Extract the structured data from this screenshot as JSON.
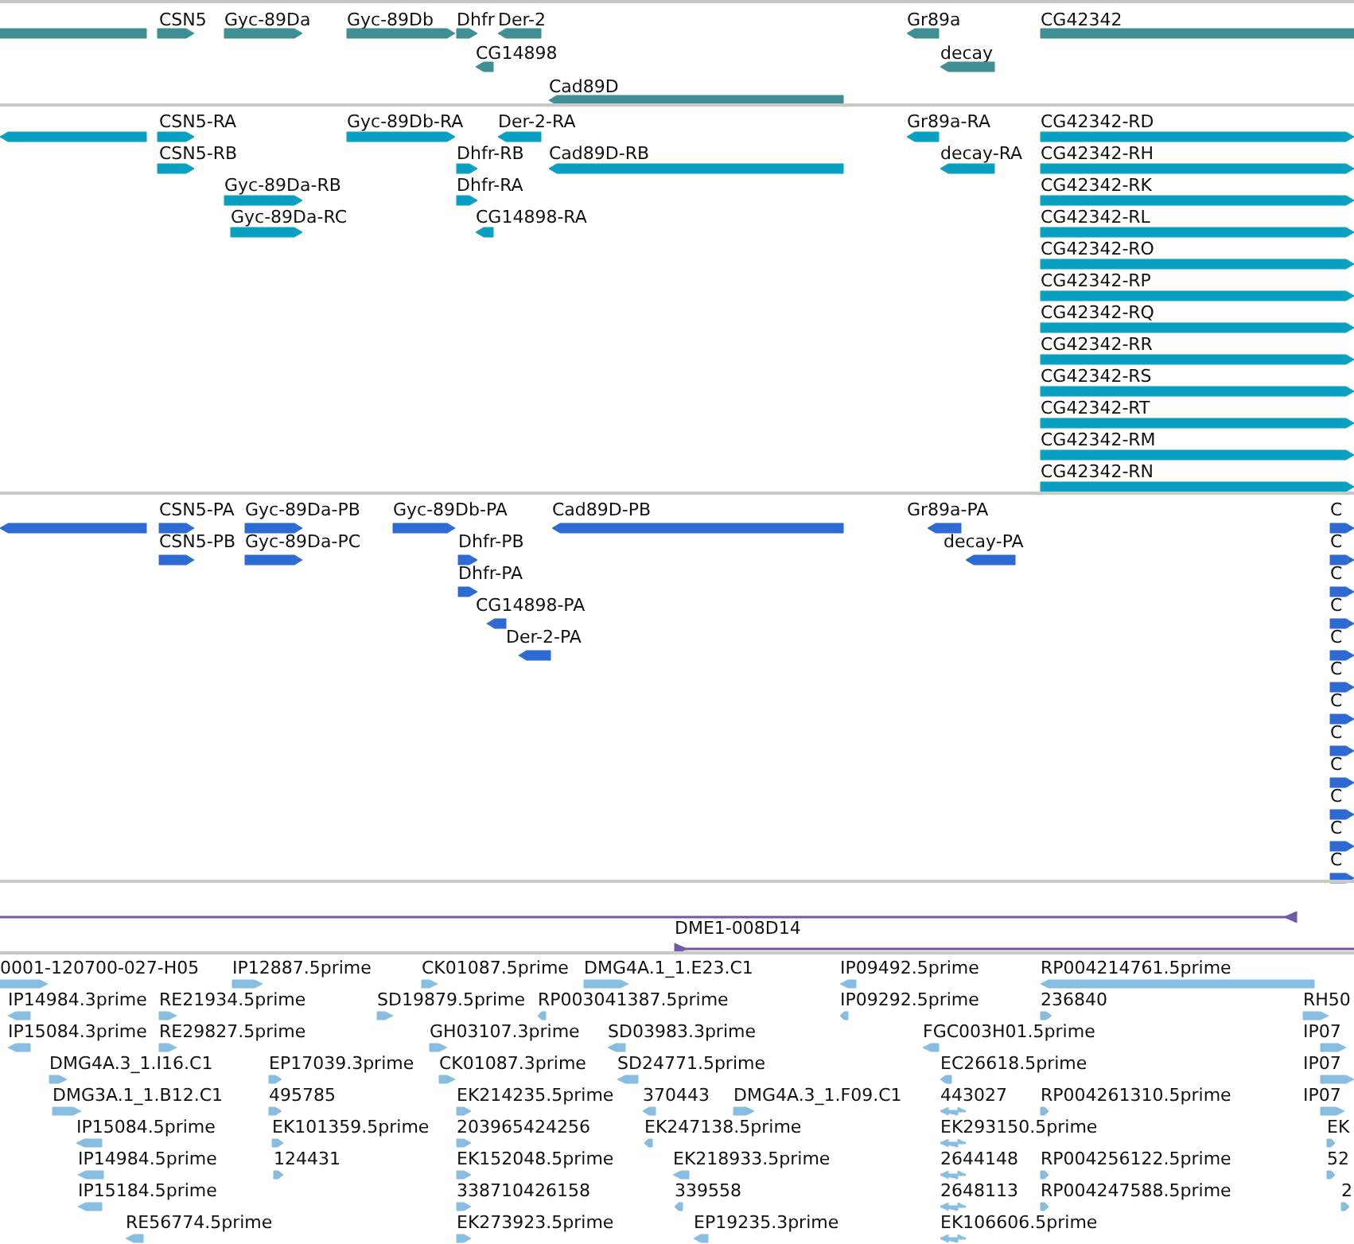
{
  "tracks": [
    {
      "kind": "bar",
      "color": "#3f8f94",
      "features": [
        {
          "kind": "plain"
        },
        {
          "label": "CSN5",
          "kind": "forward"
        },
        {
          "label": "Gyc-89Da",
          "kind": "forward"
        },
        {
          "label": "Gyc-89Db",
          "kind": "forward"
        },
        {
          "label": "Dhfr",
          "kind": "forward"
        },
        {
          "label": "Der-2",
          "kind": "reverse"
        },
        {
          "label": "Gr89a",
          "kind": "reverse"
        },
        {
          "label": "CG42342",
          "kind": "plain"
        },
        {
          "label": "CG14898",
          "kind": "reverse"
        },
        {
          "label": "decay",
          "kind": "reverse"
        },
        {
          "label": "Cad89D",
          "kind": "reverse"
        }
      ]
    },
    {
      "kind": "bar",
      "color": "#0aa0c3",
      "features": [
        {
          "kind": "reverse"
        },
        {
          "label": "CSN5-RA",
          "kind": "forward"
        },
        {
          "label": "Gyc-89Db-RA",
          "kind": "forward"
        },
        {
          "label": "Der-2-RA",
          "kind": "reverse"
        },
        {
          "label": "Gr89a-RA",
          "kind": "reverse"
        },
        {
          "label": "CG42342-RD",
          "kind": "forward"
        },
        {
          "label": "CSN5-RB",
          "kind": "forward"
        },
        {
          "label": "Dhfr-RB",
          "kind": "forward"
        },
        {
          "label": "Cad89D-RB",
          "kind": "reverse"
        },
        {
          "label": "decay-RA",
          "kind": "reverse"
        },
        {
          "label": "CG42342-RH",
          "kind": "forward"
        },
        {
          "label": "Gyc-89Da-RB",
          "kind": "forward"
        },
        {
          "label": "Dhfr-RA",
          "kind": "forward"
        },
        {
          "label": "CG42342-RK",
          "kind": "forward"
        },
        {
          "label": "Gyc-89Da-RC",
          "kind": "forward"
        },
        {
          "label": "CG14898-RA",
          "kind": "reverse"
        },
        {
          "label": "CG42342-RL",
          "kind": "forward"
        },
        {
          "label": "CG42342-RO",
          "kind": "forward"
        },
        {
          "label": "CG42342-RP",
          "kind": "forward"
        },
        {
          "label": "CG42342-RQ",
          "kind": "forward"
        },
        {
          "label": "CG42342-RR",
          "kind": "forward"
        },
        {
          "label": "CG42342-RS",
          "kind": "forward"
        },
        {
          "label": "CG42342-RT",
          "kind": "forward"
        },
        {
          "label": "CG42342-RM",
          "kind": "forward"
        },
        {
          "label": "CG42342-RN",
          "kind": "forward"
        }
      ]
    },
    {
      "kind": "bar",
      "color": "#2d6bd3",
      "features": [
        {
          "kind": "reverse"
        },
        {
          "label": "CSN5-PA",
          "kind": "forward"
        },
        {
          "label": "Gyc-89Da-PB",
          "kind": "forward"
        },
        {
          "label": "Gyc-89Db-PA",
          "kind": "forward"
        },
        {
          "label": "Cad89D-PB",
          "kind": "reverse"
        },
        {
          "label": "Gr89a-PA",
          "kind": "reverse"
        },
        {
          "label": "CSN5-PB",
          "kind": "forward"
        },
        {
          "label": "Gyc-89Da-PC",
          "kind": "forward"
        },
        {
          "label": "Dhfr-PB",
          "kind": "forward"
        },
        {
          "label": "decay-PA",
          "kind": "reverse"
        },
        {
          "label": "Dhfr-PA",
          "kind": "forward"
        },
        {
          "label": "CG14898-PA",
          "kind": "reverse"
        },
        {
          "label": "Der-2-PA",
          "kind": "reverse"
        },
        {
          "label": "C",
          "kind": "forward"
        },
        {
          "label": "C",
          "kind": "forward"
        },
        {
          "label": "C",
          "kind": "forward"
        },
        {
          "label": "C",
          "kind": "forward"
        },
        {
          "label": "C",
          "kind": "forward"
        },
        {
          "label": "C",
          "kind": "forward"
        },
        {
          "label": "C",
          "kind": "forward"
        },
        {
          "label": "C",
          "kind": "forward"
        },
        {
          "label": "C",
          "kind": "forward"
        },
        {
          "label": "C",
          "kind": "forward"
        },
        {
          "label": "C",
          "kind": "forward"
        },
        {
          "label": "C",
          "kind": "forward"
        }
      ]
    },
    {
      "kind": "line",
      "color": "#7458a8",
      "features": [
        {
          "kind": "reverse"
        },
        {
          "label": "DME1-008D14",
          "kind": "forward"
        }
      ]
    },
    {
      "kind": "bar",
      "color": "#86bde0",
      "features": [
        {
          "label": "0001-120700-027-H05",
          "kind": "forward"
        },
        {
          "label": "IP12887.5prime",
          "kind": "forward"
        },
        {
          "label": "CK01087.5prime",
          "kind": "forward"
        },
        {
          "label": "DMG4A.1_1.E23.C1",
          "kind": "forward"
        },
        {
          "label": "IP09492.5prime",
          "kind": "reverse"
        },
        {
          "label": "RP004214761.5prime",
          "kind": "reverse"
        },
        {
          "label": "IP14984.3prime",
          "kind": "reverse"
        },
        {
          "label": "RE21934.5prime",
          "kind": "forward"
        },
        {
          "label": "SD19879.5prime",
          "kind": "forward"
        },
        {
          "label": "RP003041387.5prime",
          "kind": "reverse"
        },
        {
          "label": "IP09292.5prime",
          "kind": "reverse"
        },
        {
          "label": "236840",
          "kind": "forward"
        },
        {
          "label": "RH50",
          "kind": "forward"
        },
        {
          "label": "IP15084.3prime",
          "kind": "reverse"
        },
        {
          "label": "RE29827.5prime",
          "kind": "forward"
        },
        {
          "label": "GH03107.3prime",
          "kind": "forward"
        },
        {
          "label": "SD03983.3prime",
          "kind": "reverse"
        },
        {
          "label": "FGC003H01.5prime",
          "kind": "reverse"
        },
        {
          "label": "IP07",
          "kind": "forward"
        },
        {
          "label": "DMG4A.3_1.I16.C1",
          "kind": "forward"
        },
        {
          "label": "EP17039.3prime",
          "kind": "forward"
        },
        {
          "label": "CK01087.3prime",
          "kind": "forward"
        },
        {
          "label": "SD24771.5prime",
          "kind": "reverse"
        },
        {
          "label": "EC26618.5prime",
          "kind": "reverse"
        },
        {
          "label": "IP07",
          "kind": "forward"
        },
        {
          "label": "DMG3A.1_1.B12.C1",
          "kind": "forward"
        },
        {
          "label": "495785",
          "kind": "forward"
        },
        {
          "label": "EK214235.5prime",
          "kind": "forward"
        },
        {
          "label": "370443",
          "kind": "reverse"
        },
        {
          "label": "DMG4A.3_1.F09.C1",
          "kind": "forward"
        },
        {
          "label": "443027",
          "kind": "both"
        },
        {
          "label": "RP004261310.5prime",
          "kind": "forward"
        },
        {
          "label": "IP07",
          "kind": "forward"
        },
        {
          "label": "IP15084.5prime",
          "kind": "reverse"
        },
        {
          "label": "EK101359.5prime",
          "kind": "forward"
        },
        {
          "label": "203965424256",
          "kind": "forward"
        },
        {
          "label": "EK247138.5prime",
          "kind": "reverse"
        },
        {
          "label": "EK293150.5prime",
          "kind": "both"
        },
        {
          "label": "EK",
          "kind": "forward"
        },
        {
          "label": "IP14984.5prime",
          "kind": "reverse"
        },
        {
          "label": "124431",
          "kind": "forward"
        },
        {
          "label": "EK152048.5prime",
          "kind": "forward"
        },
        {
          "label": "EK218933.5prime",
          "kind": "reverse"
        },
        {
          "label": "2644148",
          "kind": "both"
        },
        {
          "label": "RP004256122.5prime",
          "kind": "forward"
        },
        {
          "label": "52",
          "kind": "forward"
        },
        {
          "label": "IP15184.5prime",
          "kind": "reverse"
        },
        {
          "label": "338710426158",
          "kind": "forward"
        },
        {
          "label": "339558",
          "kind": "reverse"
        },
        {
          "label": "2648113",
          "kind": "both"
        },
        {
          "label": "RP004247588.5prime",
          "kind": "forward"
        },
        {
          "label": "2",
          "kind": "forward"
        },
        {
          "label": "RE56774.5prime",
          "kind": "reverse"
        },
        {
          "label": "EK273923.5prime",
          "kind": "forward"
        },
        {
          "label": "EP19235.3prime",
          "kind": "reverse"
        },
        {
          "label": "EK106606.5prime",
          "kind": "both"
        }
      ]
    }
  ]
}
